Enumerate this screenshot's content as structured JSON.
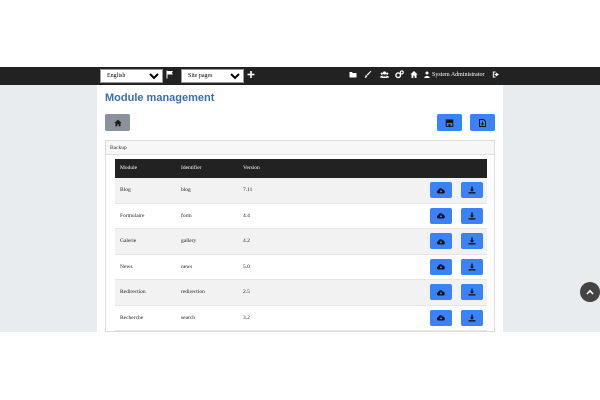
{
  "toolbar": {
    "language": {
      "selected": "English"
    },
    "site_pages": {
      "selected": "Site pages"
    },
    "user_label": "System Administrator",
    "icons": [
      "flag-icon",
      "plus-icon",
      "folder-icon",
      "brush-icon",
      "users-icon",
      "cogs-icon",
      "home-icon",
      "user-icon",
      "sign-out-icon"
    ]
  },
  "page": {
    "title": "Module management"
  },
  "card": {
    "header": "Backup"
  },
  "table": {
    "headers": {
      "module": "Module",
      "identifier": "Identifier",
      "version": "Version"
    },
    "rows": [
      {
        "module": "Blog",
        "identifier": "blog",
        "version": "7.11"
      },
      {
        "module": "Formulaire",
        "identifier": "form",
        "version": "4.4"
      },
      {
        "module": "Galerie",
        "identifier": "gallery",
        "version": "4.2"
      },
      {
        "module": "News",
        "identifier": "news",
        "version": "5.0"
      },
      {
        "module": "Redirection",
        "identifier": "redirection",
        "version": "2.5"
      },
      {
        "module": "Recherche",
        "identifier": "search",
        "version": "3.2"
      }
    ]
  },
  "colors": {
    "topbar": "#222222",
    "accent": "#3b82f6",
    "title": "#3a6fb5",
    "background": "#e9ecef"
  }
}
